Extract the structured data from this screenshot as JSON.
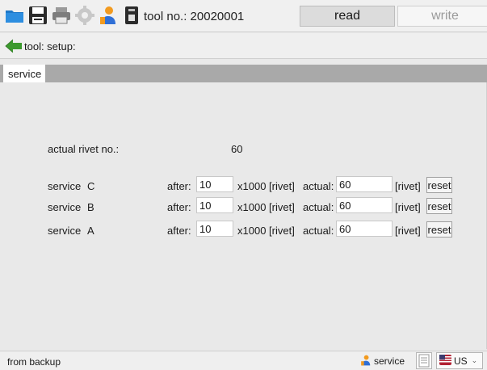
{
  "toolbar": {
    "icons": [
      "folder-icon",
      "save-icon",
      "printer-icon",
      "settings-gear-icon",
      "service-user-icon",
      "device-usb-icon"
    ],
    "tool_no_label": "tool no.: 20020001",
    "read_label": "read",
    "write_label": "write"
  },
  "breadcrumb": {
    "back_icon": "back-arrow-icon",
    "text": "tool: setup:"
  },
  "tabs": [
    {
      "label": "service",
      "active": true
    }
  ],
  "main": {
    "actual_rivet_label": "actual rivet no.:",
    "actual_rivet_value": "60",
    "services": [
      {
        "name": "service",
        "letter": "C",
        "after_label": "after:",
        "after_value": "10",
        "unit_after": "x1000 [rivet]",
        "actual_label": "actual:",
        "actual_value": "60",
        "unit_actual": "[rivet]",
        "reset_label": "reset"
      },
      {
        "name": "service",
        "letter": "B",
        "after_label": "after:",
        "after_value": "10",
        "unit_after": "x1000 [rivet]",
        "actual_label": "actual:",
        "actual_value": "60",
        "unit_actual": "[rivet]",
        "reset_label": "reset"
      },
      {
        "name": "service",
        "letter": "A",
        "after_label": "after:",
        "after_value": "10",
        "unit_after": "x1000 [rivet]",
        "actual_label": "actual:",
        "actual_value": "60",
        "unit_actual": "[rivet]",
        "reset_label": "reset"
      }
    ]
  },
  "statusbar": {
    "left_text": "from backup",
    "service_label": "service",
    "locale_label": "US"
  },
  "colors": {
    "tab_strip": "#a9a9a9",
    "back_arrow": "#3c9a2e",
    "service_icon_blue": "#2f6fd6",
    "service_icon_orange": "#f29a1f"
  }
}
